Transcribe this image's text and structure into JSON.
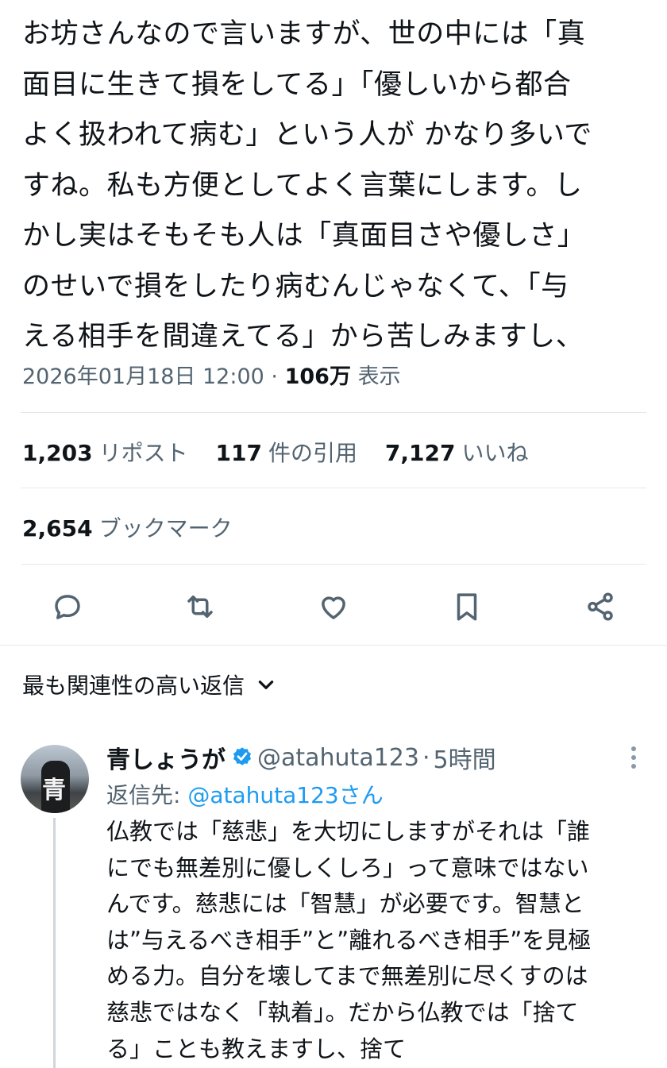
{
  "post": {
    "text": "お坊さんなので言いますが、世の中には「真\n面目に生きて損をしてる」「優しいから都合\nよく扱われて病む」という人が かなり多いで\nすね。私も方便としてよく言葉にします。し\nかし実はそもそも人は「真面目さや優しさ」\nのせいで損をしたり病むんじゃなくて、「与\nえる相手を間違えてる」から苦しみますし、",
    "timestamp": "2026年01月18日 12:00",
    "separator": "·",
    "views_count": "106万",
    "views_label": "表示"
  },
  "stats": {
    "reposts_count": "1,203",
    "reposts_label": "リポスト",
    "quotes_count": "117",
    "quotes_label": "件の引用",
    "likes_count": "7,127",
    "likes_label": "いいね",
    "bookmarks_count": "2,654",
    "bookmarks_label": "ブックマーク"
  },
  "actions": [
    "reply-icon",
    "repost-icon",
    "like-icon",
    "bookmark-icon",
    "share-icon"
  ],
  "replies_section": {
    "title": "最も関連性の高い返信"
  },
  "reply": {
    "avatar_char": "青",
    "display_name": "青しょうが",
    "handle": "@atahuta123",
    "separator": "·",
    "time": "5時間",
    "reply_to_label": "返信先: ",
    "reply_to_handle": "@atahuta123さん",
    "text": "仏教では「慈悲」を大切にしますがそれは「誰\nにでも無差別に優しくしろ」って意味ではない\nんです。慈悲には「智慧」が必要です。智慧と\nは”与えるべき相手”と”離れるべき相手”を見極\nめる力。自分を壊してまで無差別に尽くすのは\n慈悲ではなく「執着」。だから仏教では「捨て\nる」ことも教えますし、捨て"
  },
  "colors": {
    "text": "#0f1419",
    "secondary": "#536471",
    "link": "#1d9bf0",
    "verified": "#1d9bf0",
    "divider": "#e4e8ea"
  }
}
